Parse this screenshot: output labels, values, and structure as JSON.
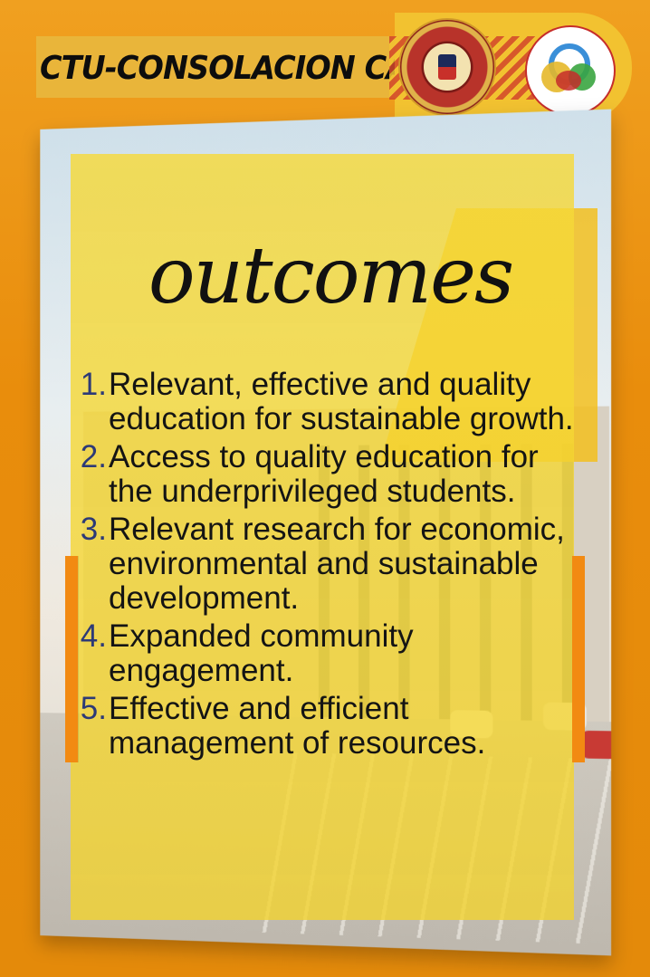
{
  "header": {
    "campus_title": "CTU-CONSOLACION CAMPUS",
    "university_seal": "cebu-technological-university-seal",
    "campus_logo": "consolacion-campus-logo"
  },
  "main": {
    "heading": "outcomes",
    "outcomes": [
      {
        "number": "1.",
        "text": "Relevant, effective and quality education for sustainable growth."
      },
      {
        "number": "2.",
        "text": "Access to quality education for the underprivileged students."
      },
      {
        "number": "3.",
        "text": "Relevant research for economic, environmental and sustainable development."
      },
      {
        "number": "4.",
        "text": "Expanded community engagement."
      },
      {
        "number": "5.",
        "text": "Effective and efficient management of resources."
      }
    ]
  },
  "colors": {
    "background": "#e8920f",
    "overlay": "#f4d32b",
    "accent_orange": "#f28a12",
    "number_blue": "#2d3a77"
  }
}
